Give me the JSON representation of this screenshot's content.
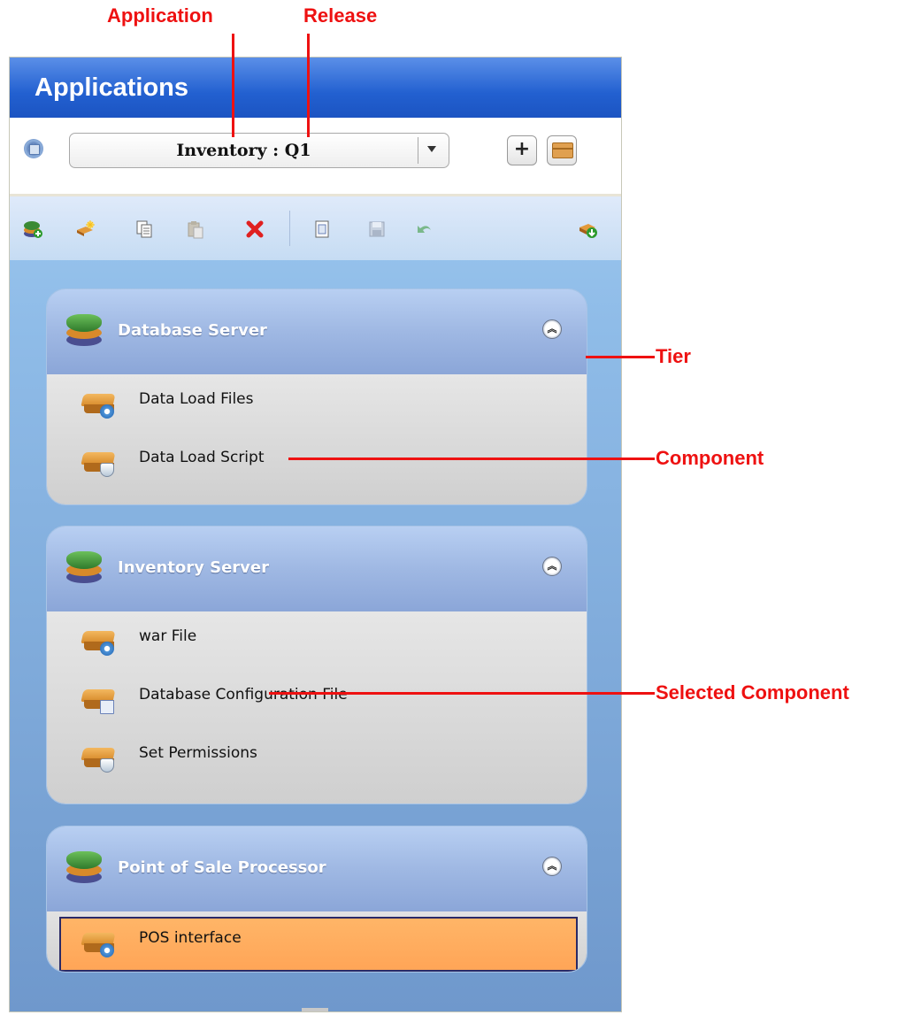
{
  "annotations": {
    "application": "Application",
    "release": "Release",
    "tier": "Tier",
    "component": "Component",
    "selected_component": "Selected Component"
  },
  "panel": {
    "title": "Applications",
    "selector": {
      "value": "Inventory : Q1"
    },
    "toolbar_icons": [
      "add-tier-icon",
      "new-component-icon",
      "copy-icon",
      "paste-icon",
      "delete-icon",
      "properties-icon",
      "save-icon",
      "undo-icon",
      "deploy-icon"
    ]
  },
  "tiers": [
    {
      "name": "Database Server",
      "components": [
        {
          "label": "Data Load Files",
          "icon": "component-gear-icon"
        },
        {
          "label": "Data Load Script",
          "icon": "component-script-icon"
        }
      ]
    },
    {
      "name": "Inventory Server",
      "components": [
        {
          "label": "war File",
          "icon": "component-gear-icon"
        },
        {
          "label": "Database Configuration File",
          "icon": "component-config-icon"
        },
        {
          "label": "Set Permissions",
          "icon": "component-script-icon"
        }
      ]
    },
    {
      "name": "Point of Sale Processor",
      "components": [
        {
          "label": "POS interface",
          "icon": "component-gear-icon",
          "selected": true
        }
      ]
    }
  ],
  "colors": {
    "callout": "#ee1111",
    "selected_fill": "#ffa557",
    "title_bar": "#2260d0"
  }
}
